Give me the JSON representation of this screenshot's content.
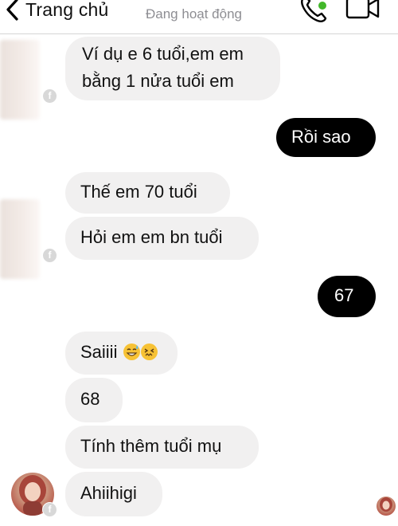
{
  "header": {
    "back_label": "Trang chủ",
    "status": "Đang hoạt động",
    "call_icon": "phone-icon",
    "video_icon": "video-camera-icon",
    "accent_color": "#000000",
    "active_dot_color": "#42b72a"
  },
  "messages": [
    {
      "side": "in",
      "text": "Ví dụ e 6 tuổi,em em",
      "text2": "bằng 1 nửa tuổi em"
    },
    {
      "side": "out",
      "text": "Rồi sao"
    },
    {
      "side": "in",
      "text": "Thế em 70 tuổi"
    },
    {
      "side": "in",
      "text": "Hỏi em em bn tuổi"
    },
    {
      "side": "out",
      "text": "67"
    },
    {
      "side": "in",
      "text": "Saiiii",
      "emojis": [
        "grinning-sweat-emoji",
        "confounded-emoji"
      ]
    },
    {
      "side": "in",
      "text": "68"
    },
    {
      "side": "in",
      "text": "Tính thêm tuổi mụ"
    },
    {
      "side": "in",
      "text": "Ahiihigi"
    }
  ],
  "colors": {
    "incoming_bubble": "#f1f0f0",
    "outgoing_bubble": "#000000"
  }
}
